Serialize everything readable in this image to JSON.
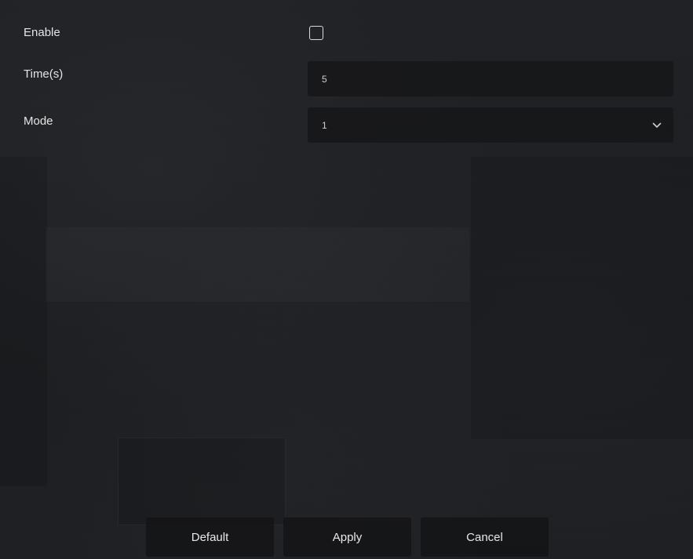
{
  "form": {
    "enable": {
      "label": "Enable",
      "checked": false
    },
    "time": {
      "label": "Time(s)",
      "value": "5"
    },
    "mode": {
      "label": "Mode",
      "selected": "1",
      "icon": "chevron-down-icon"
    }
  },
  "actions": {
    "default_label": "Default",
    "apply_label": "Apply",
    "cancel_label": "Cancel"
  },
  "colors": {
    "background": "#1d1f23",
    "field": "#161618",
    "text": "#e4e4e4"
  }
}
